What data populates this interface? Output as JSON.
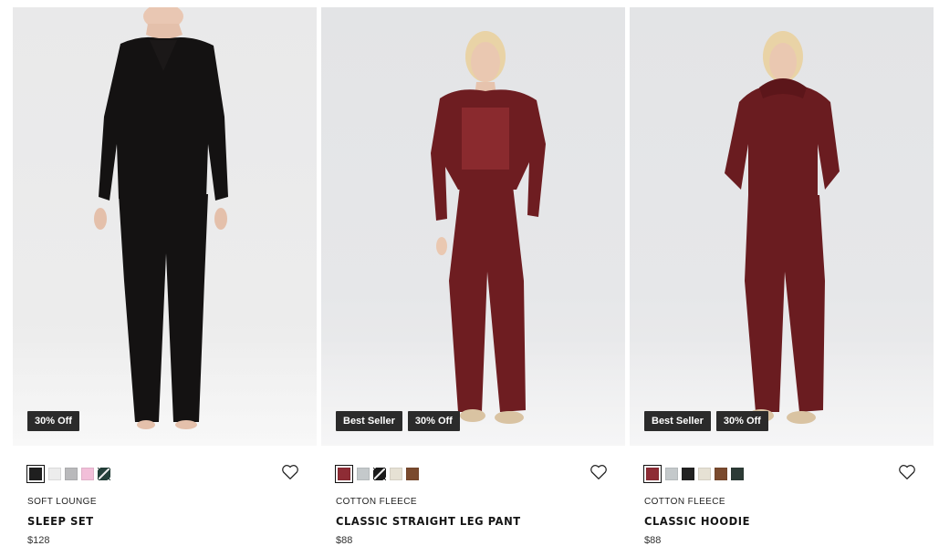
{
  "products": [
    {
      "collection": "SOFT LOUNGE",
      "name": "SLEEP SET",
      "price": "$128",
      "badges": [
        "30% Off"
      ],
      "swatches": [
        "#1f1f1f",
        "#ececec",
        "#b9b9bb",
        "#f2bfd9",
        "striped-dark-green"
      ],
      "selected_swatch": 0,
      "garment_color": "#141212"
    },
    {
      "collection": "COTTON FLEECE",
      "name": "CLASSIC STRAIGHT LEG PANT",
      "price": "$88",
      "badges": [
        "Best Seller",
        "30% Off"
      ],
      "swatches": [
        "#8e2c35",
        "#c4c9cb",
        "striped-black",
        "#e6e1d4",
        "#7a4a2e"
      ],
      "selected_swatch": 0,
      "garment_color": "#6e1d21"
    },
    {
      "collection": "COTTON FLEECE",
      "name": "CLASSIC HOODIE",
      "price": "$88",
      "badges": [
        "Best Seller",
        "30% Off"
      ],
      "swatches": [
        "#8e2c35",
        "#c4c9cb",
        "#222222",
        "#e6e1d4",
        "#7a4a2e",
        "#2d3b36"
      ],
      "selected_swatch": 0,
      "garment_color": "#6a1c20"
    }
  ],
  "icons": {
    "wishlist": "heart-outline-icon"
  }
}
